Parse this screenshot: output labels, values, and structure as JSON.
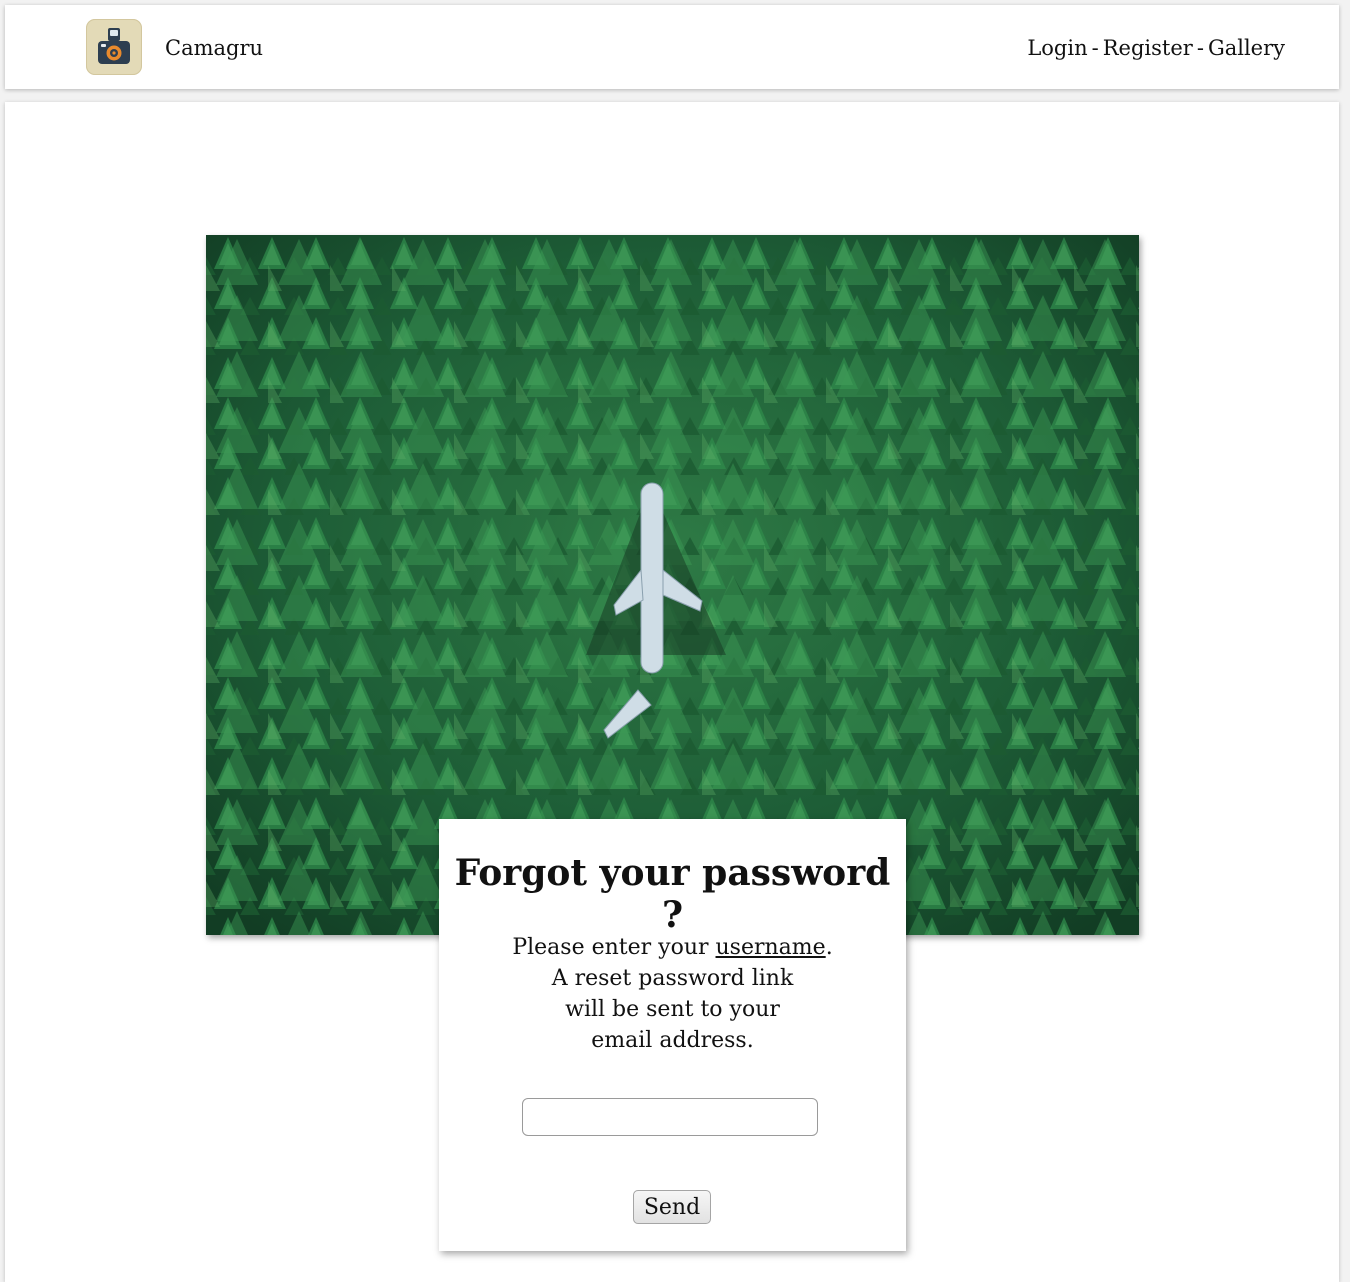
{
  "header": {
    "logo_icon": "camera-icon",
    "brand": "Camagru",
    "nav": {
      "login": "Login",
      "register": "Register",
      "gallery": "Gallery",
      "separator": "-"
    }
  },
  "hero": {
    "image_icon": "forest-airplane-photo",
    "colors": {
      "forest": "#1f5b35",
      "plane": "#cfdde6"
    }
  },
  "form": {
    "title": "Forgot your password ?",
    "message_prefix": "Please enter your",
    "message_keyword": "username",
    "message_suffix": ".",
    "message_line2": "A reset password link",
    "message_line3": "will be sent to your",
    "message_line4": "email address.",
    "input_value": "",
    "input_placeholder": "",
    "send_label": "Send"
  }
}
